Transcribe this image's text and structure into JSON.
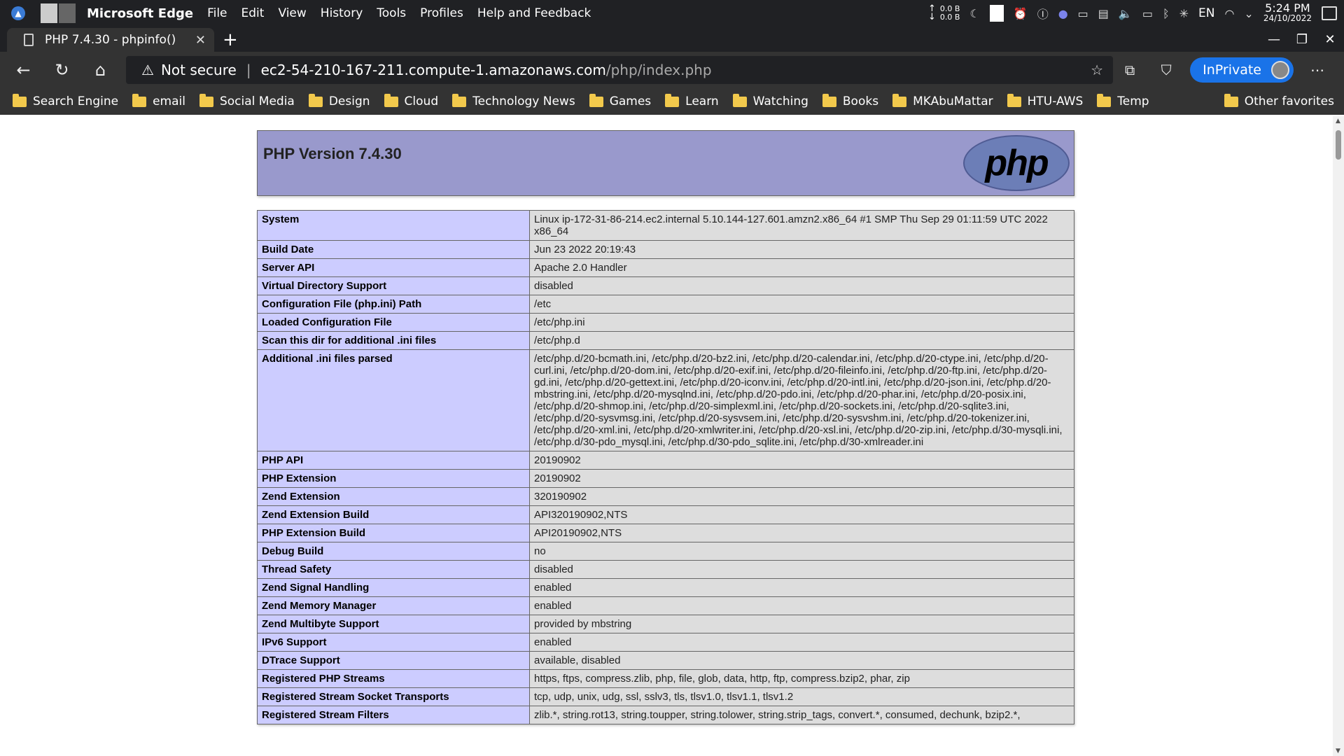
{
  "system_bar": {
    "app_name": "Microsoft Edge",
    "menu": [
      "File",
      "Edit",
      "View",
      "History",
      "Tools",
      "Profiles",
      "Help and Feedback"
    ],
    "net_up": "0.0 B",
    "net_down": "0.0 B",
    "language": "EN",
    "time": "5:24 PM",
    "date": "24/10/2022"
  },
  "tab": {
    "title": "PHP 7.4.30 - phpinfo()"
  },
  "address_bar": {
    "security": "Not secure",
    "host": "ec2-54-210-167-211.compute-1.amazonaws.com",
    "path": "/php/index.php",
    "inprivate_label": "InPrivate"
  },
  "favorites": [
    "Search Engine",
    "email",
    "Social Media",
    "Design",
    "Cloud",
    "Technology News",
    "Games",
    "Learn",
    "Watching",
    "Books",
    "MKAbuMattar",
    "HTU-AWS",
    "Temp"
  ],
  "favorites_other": "Other favorites",
  "page": {
    "version_title": "PHP Version 7.4.30",
    "logo_text": "php",
    "rows": [
      {
        "key": "System",
        "value": "Linux ip-172-31-86-214.ec2.internal 5.10.144-127.601.amzn2.x86_64 #1 SMP Thu Sep 29 01:11:59 UTC 2022 x86_64"
      },
      {
        "key": "Build Date",
        "value": "Jun 23 2022 20:19:43"
      },
      {
        "key": "Server API",
        "value": "Apache 2.0 Handler"
      },
      {
        "key": "Virtual Directory Support",
        "value": "disabled"
      },
      {
        "key": "Configuration File (php.ini) Path",
        "value": "/etc"
      },
      {
        "key": "Loaded Configuration File",
        "value": "/etc/php.ini"
      },
      {
        "key": "Scan this dir for additional .ini files",
        "value": "/etc/php.d"
      },
      {
        "key": "Additional .ini files parsed",
        "value": "/etc/php.d/20-bcmath.ini, /etc/php.d/20-bz2.ini, /etc/php.d/20-calendar.ini, /etc/php.d/20-ctype.ini, /etc/php.d/20-curl.ini, /etc/php.d/20-dom.ini, /etc/php.d/20-exif.ini, /etc/php.d/20-fileinfo.ini, /etc/php.d/20-ftp.ini, /etc/php.d/20-gd.ini, /etc/php.d/20-gettext.ini, /etc/php.d/20-iconv.ini, /etc/php.d/20-intl.ini, /etc/php.d/20-json.ini, /etc/php.d/20-mbstring.ini, /etc/php.d/20-mysqlnd.ini, /etc/php.d/20-pdo.ini, /etc/php.d/20-phar.ini, /etc/php.d/20-posix.ini, /etc/php.d/20-shmop.ini, /etc/php.d/20-simplexml.ini, /etc/php.d/20-sockets.ini, /etc/php.d/20-sqlite3.ini, /etc/php.d/20-sysvmsg.ini, /etc/php.d/20-sysvsem.ini, /etc/php.d/20-sysvshm.ini, /etc/php.d/20-tokenizer.ini, /etc/php.d/20-xml.ini, /etc/php.d/20-xmlwriter.ini, /etc/php.d/20-xsl.ini, /etc/php.d/20-zip.ini, /etc/php.d/30-mysqli.ini, /etc/php.d/30-pdo_mysql.ini, /etc/php.d/30-pdo_sqlite.ini, /etc/php.d/30-xmlreader.ini"
      },
      {
        "key": "PHP API",
        "value": "20190902"
      },
      {
        "key": "PHP Extension",
        "value": "20190902"
      },
      {
        "key": "Zend Extension",
        "value": "320190902"
      },
      {
        "key": "Zend Extension Build",
        "value": "API320190902,NTS"
      },
      {
        "key": "PHP Extension Build",
        "value": "API20190902,NTS"
      },
      {
        "key": "Debug Build",
        "value": "no"
      },
      {
        "key": "Thread Safety",
        "value": "disabled"
      },
      {
        "key": "Zend Signal Handling",
        "value": "enabled"
      },
      {
        "key": "Zend Memory Manager",
        "value": "enabled"
      },
      {
        "key": "Zend Multibyte Support",
        "value": "provided by mbstring"
      },
      {
        "key": "IPv6 Support",
        "value": "enabled"
      },
      {
        "key": "DTrace Support",
        "value": "available, disabled"
      },
      {
        "key": "Registered PHP Streams",
        "value": "https, ftps, compress.zlib, php, file, glob, data, http, ftp, compress.bzip2, phar, zip"
      },
      {
        "key": "Registered Stream Socket Transports",
        "value": "tcp, udp, unix, udg, ssl, sslv3, tls, tlsv1.0, tlsv1.1, tlsv1.2"
      },
      {
        "key": "Registered Stream Filters",
        "value": "zlib.*, string.rot13, string.toupper, string.tolower, string.strip_tags, convert.*, consumed, dechunk, bzip2.*,"
      }
    ]
  }
}
